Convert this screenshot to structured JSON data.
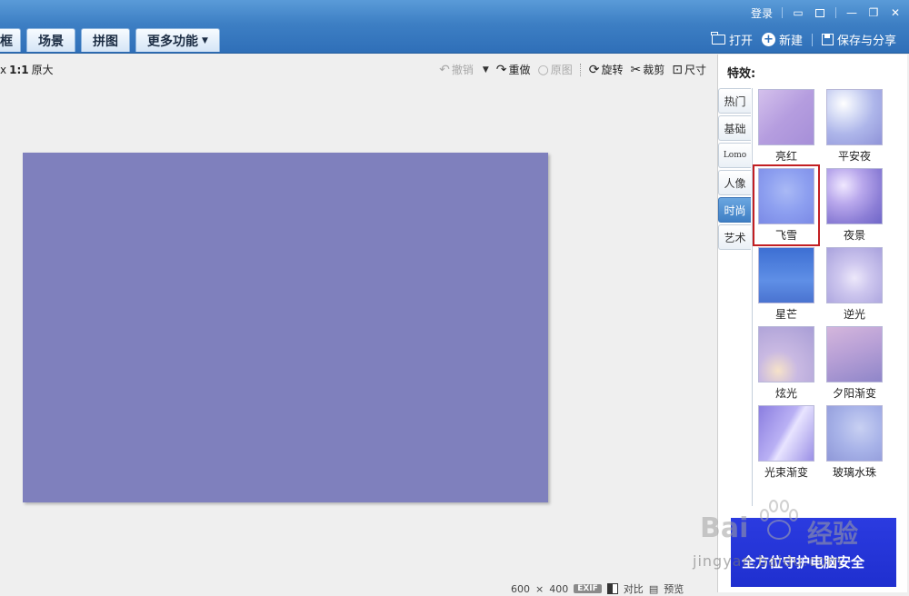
{
  "header": {
    "login_label": "登录",
    "tabs": [
      {
        "label": "框"
      },
      {
        "label": "场景"
      },
      {
        "label": "拼图"
      },
      {
        "label": "更多功能"
      }
    ],
    "actions": {
      "open_label": "打开",
      "new_label": "新建",
      "save_share_label": "保存与分享"
    }
  },
  "toolbar": {
    "zoom_ratio": "1:1",
    "zoom_label": "原大",
    "undo_label": "撤销",
    "redo_label": "重做",
    "original_label": "原图",
    "rotate_label": "旋转",
    "crop_label": "裁剪",
    "size_label": "尺寸"
  },
  "canvas": {
    "fill_color": "#7f80bd"
  },
  "status": {
    "width": "600",
    "times": "×",
    "height": "400",
    "exif_label": "EXIF",
    "compare_label": "对比",
    "preview_label": "预览"
  },
  "panel": {
    "title": "特效:",
    "categories": [
      {
        "label": "热门"
      },
      {
        "label": "基础"
      },
      {
        "label": "Lomo"
      },
      {
        "label": "人像"
      },
      {
        "label": "时尚"
      },
      {
        "label": "艺术"
      }
    ],
    "active_category": "时尚",
    "effects": [
      {
        "label": "亮红"
      },
      {
        "label": "平安夜"
      },
      {
        "label": "飞雪"
      },
      {
        "label": "夜景"
      },
      {
        "label": "星芒"
      },
      {
        "label": "逆光"
      },
      {
        "label": "炫光"
      },
      {
        "label": "夕阳渐变"
      },
      {
        "label": "光束渐变"
      },
      {
        "label": "玻璃水珠"
      }
    ],
    "selected_effect": "飞雪",
    "ad_text": "全方位守护电脑安全"
  },
  "watermark": {
    "brand": "Bai",
    "brand_cn": "经验",
    "url": "jingyan.baidu.com"
  },
  "colors": {
    "header_blue": "#3d7fc4",
    "selection_red": "#c21f23",
    "active_tab_blue": "#4f8fd2"
  }
}
